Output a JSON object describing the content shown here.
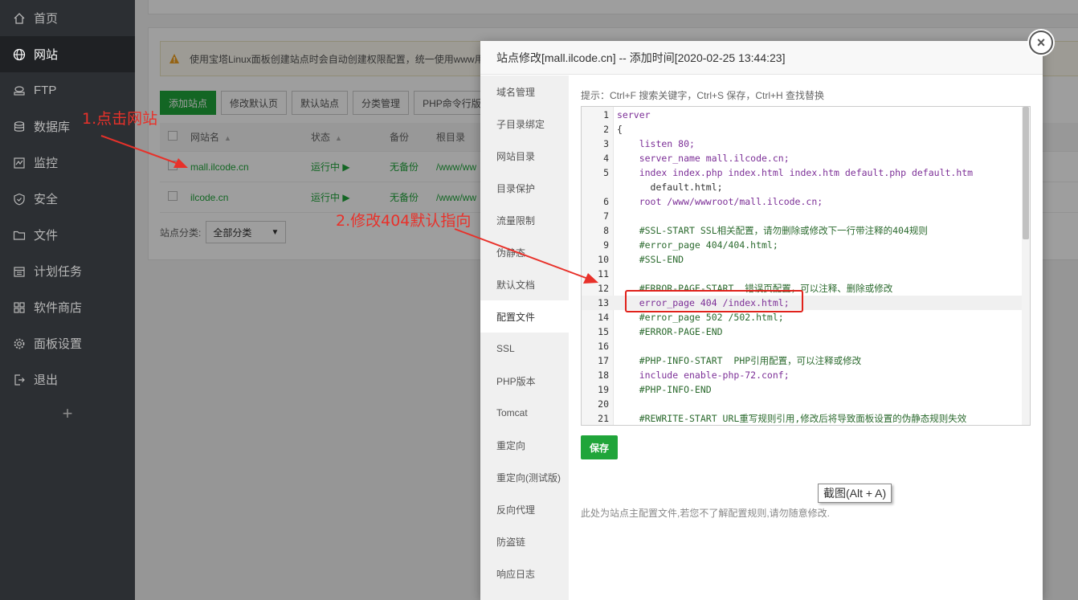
{
  "sidebar": {
    "items": [
      {
        "label": "首页",
        "icon": "home-icon"
      },
      {
        "label": "网站",
        "icon": "globe-icon"
      },
      {
        "label": "FTP",
        "icon": "ftp-icon"
      },
      {
        "label": "数据库",
        "icon": "database-icon"
      },
      {
        "label": "监控",
        "icon": "monitor-icon"
      },
      {
        "label": "安全",
        "icon": "shield-icon"
      },
      {
        "label": "文件",
        "icon": "folder-icon"
      },
      {
        "label": "计划任务",
        "icon": "calendar-icon"
      },
      {
        "label": "软件商店",
        "icon": "grid-icon"
      },
      {
        "label": "面板设置",
        "icon": "gear-icon"
      },
      {
        "label": "退出",
        "icon": "logout-icon"
      }
    ],
    "add": "+"
  },
  "main": {
    "warning": "使用宝塔Linux面板创建站点时会自动创建权限配置，统一使用www用",
    "buttons": [
      "添加站点",
      "修改默认页",
      "默认站点",
      "分类管理",
      "PHP命令行版本"
    ],
    "headers": {
      "name": "网站名",
      "status": "状态",
      "backup": "备份",
      "root": "根目录"
    },
    "rows": [
      {
        "name": "mall.ilcode.cn",
        "status": "运行中 ▶",
        "backup": "无备份",
        "root": "/www/ww"
      },
      {
        "name": "ilcode.cn",
        "status": "运行中 ▶",
        "backup": "无备份",
        "root": "/www/ww"
      }
    ],
    "category_label": "站点分类:",
    "category_value": "全部分类"
  },
  "annotations": {
    "step1": "1.点击网站",
    "step2": "2.修改404默认指向"
  },
  "modal": {
    "title": "站点修改[mall.ilcode.cn] -- 添加时间[2020-02-25 13:44:23]",
    "close": "×",
    "nav": [
      "域名管理",
      "子目录绑定",
      "网站目录",
      "目录保护",
      "流量限制",
      "伪静态",
      "默认文档",
      "配置文件",
      "SSL",
      "PHP版本",
      "Tomcat",
      "重定向",
      "重定向(测试版)",
      "反向代理",
      "防盗链",
      "响应日志"
    ],
    "active_nav": "配置文件",
    "hint": "提示：Ctrl+F 搜索关键字，Ctrl+S 保存，Ctrl+H 查找替换",
    "code": [
      {
        "n": "1",
        "t": "server"
      },
      {
        "n": "2",
        "t": "{"
      },
      {
        "n": "3",
        "t": "    listen 80;"
      },
      {
        "n": "4",
        "t": "    server_name mall.ilcode.cn;"
      },
      {
        "n": "5",
        "t": "    index index.php index.html index.htm default.php default.htm"
      },
      {
        "n": "",
        "t": "      default.html;"
      },
      {
        "n": "6",
        "t": "    root /www/wwwroot/mall.ilcode.cn;"
      },
      {
        "n": "7",
        "t": ""
      },
      {
        "n": "8",
        "t": "    #SSL-START SSL相关配置，请勿删除或修改下一行带注释的404规则"
      },
      {
        "n": "9",
        "t": "    #error_page 404/404.html;"
      },
      {
        "n": "10",
        "t": "    #SSL-END"
      },
      {
        "n": "11",
        "t": ""
      },
      {
        "n": "12",
        "t": "    #ERROR-PAGE-START  错误页配置，可以注释、删除或修改"
      },
      {
        "n": "13",
        "t": "    error_page 404 /index.html;"
      },
      {
        "n": "14",
        "t": "    #error_page 502 /502.html;"
      },
      {
        "n": "15",
        "t": "    #ERROR-PAGE-END"
      },
      {
        "n": "16",
        "t": ""
      },
      {
        "n": "17",
        "t": "    #PHP-INFO-START  PHP引用配置，可以注释或修改"
      },
      {
        "n": "18",
        "t": "    include enable-php-72.conf;"
      },
      {
        "n": "19",
        "t": "    #PHP-INFO-END"
      },
      {
        "n": "20",
        "t": ""
      },
      {
        "n": "21",
        "t": "    #REWRITE-START URL重写规则引用,修改后将导致面板设置的伪静态规则失效"
      }
    ],
    "save": "保存",
    "note": "此处为站点主配置文件,若您不了解配置规则,请勿随意修改."
  },
  "tooltip": "截图(Alt + A)"
}
